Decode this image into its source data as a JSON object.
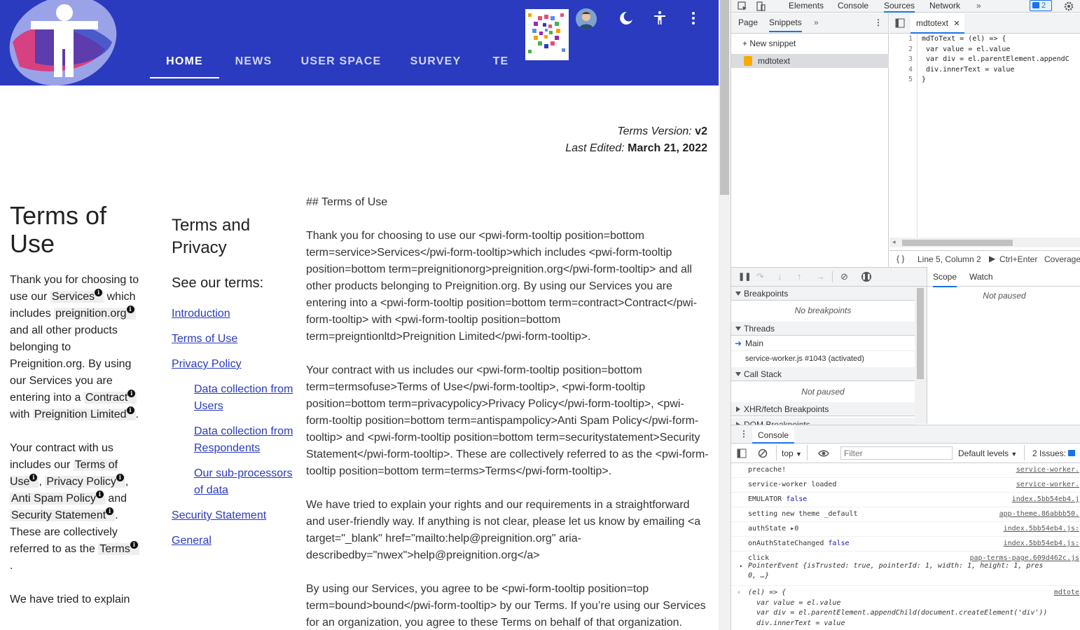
{
  "app": {
    "nav_tabs": [
      "HOME",
      "NEWS",
      "USER SPACE",
      "SURVEY",
      "TE"
    ],
    "active_tab": "HOME",
    "brand_color": "#2a3bbf",
    "meta": {
      "version_label": "Terms Version:",
      "version_value": "v2",
      "edited_label": "Last Edited:",
      "edited_value": "March 21, 2022"
    },
    "col1": {
      "title": "Terms of Use",
      "p1": {
        "t1": "Thank you for choosing to use our ",
        "term_services": "Services",
        "t2": " which includes ",
        "term_preig": "preignition.org",
        "t3": " and all other products belonging to Preignition.org. By using our Services you are entering into a ",
        "term_contract": "Contract",
        "t4": " with ",
        "term_limited": "Preignition Limited",
        "t5": "."
      },
      "p2": {
        "t1": "Your contract with us includes our ",
        "term_tou": "Terms of Use",
        "sep1": ", ",
        "term_pp": "Privacy Policy",
        "sep2": ", ",
        "term_asp": "Anti Spam Policy",
        "and": " and ",
        "term_ss": "Security Statement",
        "t2": ". These are collectively referred to as the ",
        "term_terms": "Terms",
        "t3": "."
      },
      "p3_partial": "We have tried to explain"
    },
    "col2": {
      "title": "Terms and Privacy",
      "subtitle": "See our terms:",
      "links": [
        {
          "label": "Introduction",
          "sub": false
        },
        {
          "label": "Terms of Use",
          "sub": false
        },
        {
          "label": "Privacy Policy",
          "sub": false
        },
        {
          "label": "Data collection from Users",
          "sub": true
        },
        {
          "label": "Data collection from Respondents",
          "sub": true
        },
        {
          "label": "Our sub-processors of data",
          "sub": true
        },
        {
          "label": "Security Statement",
          "sub": false
        },
        {
          "label": "General",
          "sub": false
        }
      ]
    },
    "col3": {
      "heading": "## Terms of Use",
      "paragraphs": [
        "Thank you for choosing to use our <pwi-form-tooltip position=bottom term=service>Services</pwi-form-tooltip>which includes <pwi-form-tooltip position=bottom term=preignitionorg>preignition.org</pwi-form-tooltip> and all other products belonging to Preignition.org. By using our Services you are entering into a <pwi-form-tooltip position=bottom term=contract>Contract</pwi-form-tooltip> with <pwi-form-tooltip position=bottom term=preigntionltd>Preignition Limited</pwi-form-tooltip>.",
        "Your contract with us includes our <pwi-form-tooltip position=bottom term=termsofuse>Terms of Use</pwi-form-tooltip>, <pwi-form-tooltip position=bottom term=privacypolicy>Privacy Policy</pwi-form-tooltip>, <pwi-form-tooltip position=bottom term=antispampolicy>Anti Spam Policy</pwi-form-tooltip> and <pwi-form-tooltip position=bottom term=securitystatement>Security Statement</pwi-form-tooltip>. These are collectively referred to as the <pwi-form-tooltip position=bottom term=terms>Terms</pwi-form-tooltip>.",
        "We have tried to explain your rights and our requirements in a straightforward and user-friendly way. If anything is not clear, please let us know by emailing <a target=\"_blank\" href=\"mailto:help@preignition.org\" aria-describedby=\"nwex\">help@preignition.org</a>",
        "By using our Services, you agree to be <pwi-form-tooltip position=top term=bound>bound</pwi-form-tooltip> by our Terms. If you’re using our Services for an organization, you agree to these Terms on behalf of that organization."
      ]
    }
  },
  "devtools": {
    "tabs": [
      "Elements",
      "Console",
      "Sources",
      "Network"
    ],
    "active_tab": "Sources",
    "issues_count": "2",
    "navigator": {
      "tabs": [
        "Page",
        "Snippets"
      ],
      "active": "Snippets",
      "new_snippet": "+ New snippet",
      "snippet_name": "mdtotext"
    },
    "editor": {
      "file_tab": "mdtotext",
      "line_numbers": [
        "1",
        "2",
        "3",
        "4",
        "5"
      ],
      "code": "mdToText = (el) => {\n var value = el.value\n var div = el.parentElement.appendC\n div.innerText = value\n}",
      "status": "Line 5, Column 2",
      "run_hint": "Ctrl+Enter",
      "coverage": "Coverage:"
    },
    "debugger": {
      "breakpoints_title": "Breakpoints",
      "no_breakpoints": "No breakpoints",
      "threads_title": "Threads",
      "thread_main": "Main",
      "thread_sw": "service-worker.js #1043 (activated)",
      "callstack_title": "Call Stack",
      "not_paused": "Not paused",
      "xhr_title": "XHR/fetch Breakpoints",
      "dom_title": "DOM Breakpoints"
    },
    "scope": {
      "tabs": [
        "Scope",
        "Watch"
      ],
      "status": "Not paused"
    },
    "console": {
      "title": "Console",
      "context": "top",
      "filter_placeholder": "Filter",
      "levels": "Default levels",
      "issues": "2 Issues:",
      "issues_count": "2",
      "messages": [
        {
          "text": "precache!",
          "src": "service-worker."
        },
        {
          "text": "service-worker loaded",
          "src": "service-worker."
        },
        {
          "text": "EMULATOR",
          "val": "false",
          "src": "index.5bb54eb4.j"
        },
        {
          "text": "setting new theme _default",
          "src": "app-theme.86abbb50."
        },
        {
          "text": "authState",
          "val": "▸0",
          "src": "index.5bb54eb4.js:"
        },
        {
          "text": "onAuthStateChanged",
          "val": "false",
          "src": "index.5bb54eb4.js:"
        },
        {
          "text": "click",
          "src": "pap-terms-page.609d462c.js"
        }
      ],
      "pointer_event": "PointerEvent {isTrusted: true, pointerId: 1, width: 1, height: 1, pres",
      "pointer_event_cont": "0, …}",
      "snippet_src": "mdtote",
      "snippet_echo": "(el) => {\n  var value = el.value\n  var div = el.parentElement.appendChild(document.createElement('div'))\n  div.innerText = value"
    }
  }
}
